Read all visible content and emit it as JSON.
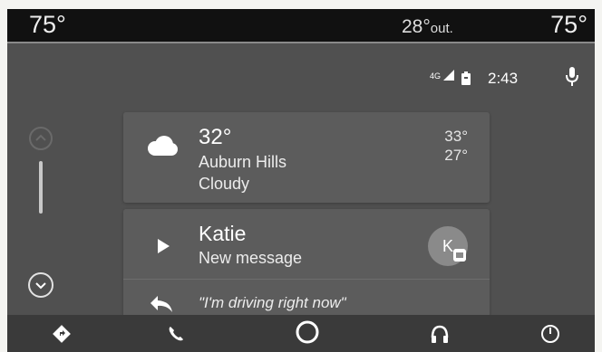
{
  "climate": {
    "driver_temp": "75°",
    "outside_temp": "28°",
    "outside_label": "out.",
    "passenger_temp": "75°"
  },
  "status_bar": {
    "signal_label": "4G",
    "time": "2:43",
    "icons": [
      "signal-icon",
      "battery-icon",
      "microphone-icon"
    ]
  },
  "scroll": {
    "up_icon": "chevron-up-icon",
    "down_icon": "chevron-down-icon"
  },
  "weather_card": {
    "icon": "cloud-icon",
    "temperature": "32°",
    "location": "Auburn Hills",
    "condition": "Cloudy",
    "high": "33°",
    "low": "27°"
  },
  "message_card": {
    "play_icon": "play-icon",
    "sender": "Katie",
    "subtitle": "New message",
    "avatar_initial": "K",
    "reply_icon": "reply-icon",
    "quick_reply": "\"I'm driving right now\""
  },
  "nav_bar": {
    "items": [
      "navigation-icon",
      "phone-icon",
      "home-icon",
      "headphones-icon",
      "exit-icon"
    ]
  },
  "colors": {
    "screen_bg": "#505050",
    "card_bg": "#5c5c5c",
    "climate_bar": "#111111",
    "nav_bar": "#3a3a3a",
    "text": "#ffffff"
  }
}
